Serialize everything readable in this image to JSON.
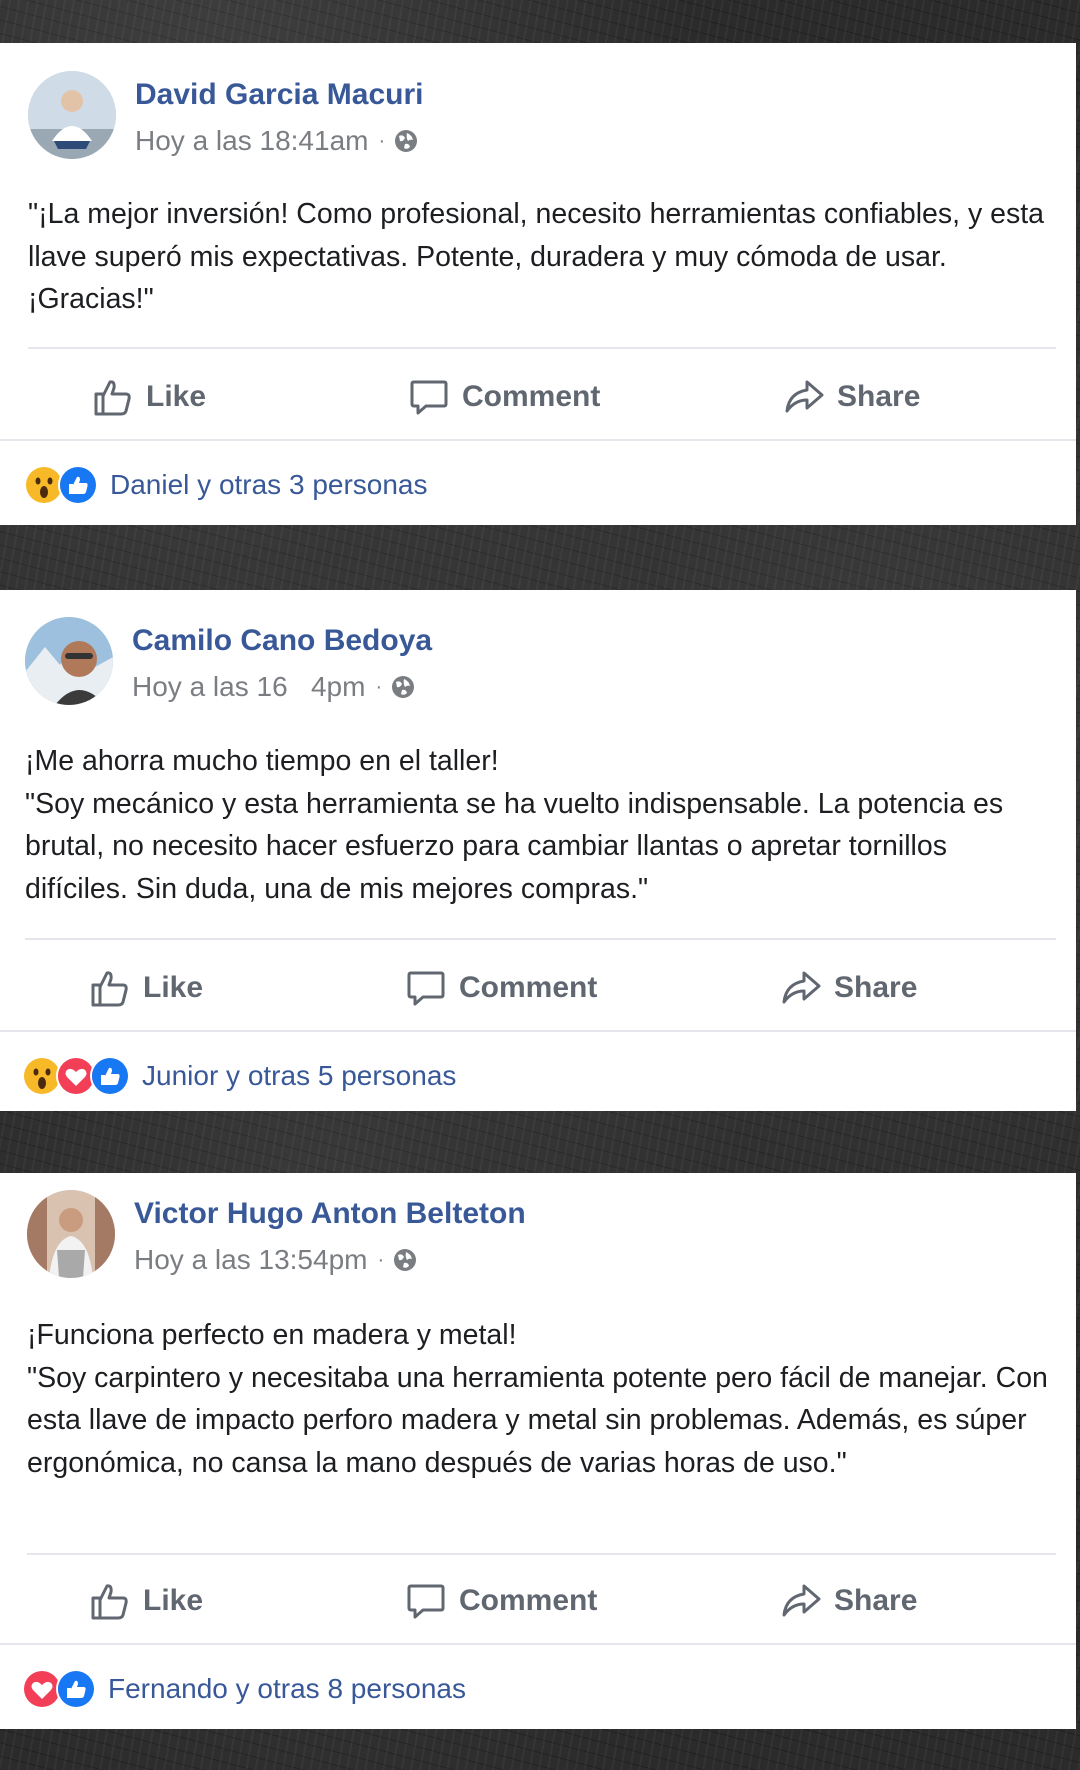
{
  "posts": [
    {
      "author": "David Garcia Macuri",
      "timestamp": "Hoy a las 18:41am",
      "visibility_icon": "globe-icon",
      "body": [
        "\"¡La mejor inversión! Como profesional, necesito herramientas confiables, y esta llave superó mis expectativas. Potente, duradera y muy cómoda de usar. ¡Gracias!\""
      ],
      "actions": {
        "like": "Like",
        "comment": "Comment",
        "share": "Share"
      },
      "reactions": [
        "wow-icon",
        "like-icon"
      ],
      "reactions_summary": "Daniel y otras 3 personas"
    },
    {
      "author": "Camilo Cano Bedoya",
      "timestamp": "Hoy a las 16   4pm",
      "visibility_icon": "globe-icon",
      "body": [
        "¡Me ahorra mucho tiempo en el taller!",
        "\"Soy mecánico y esta herramienta se ha vuelto indispensable. La potencia es brutal, no necesito hacer esfuerzo para cambiar llantas o apretar tornillos difíciles. Sin duda, una de mis mejores compras.\""
      ],
      "actions": {
        "like": "Like",
        "comment": "Comment",
        "share": "Share"
      },
      "reactions": [
        "wow-icon",
        "love-icon",
        "like-icon"
      ],
      "reactions_summary": "Junior y otras 5 personas"
    },
    {
      "author": "Victor Hugo Anton Belteton",
      "timestamp": "Hoy a las 13:54pm",
      "visibility_icon": "globe-icon",
      "body": [
        "¡Funciona perfecto en madera y metal!",
        "\"Soy carpintero y necesitaba una herramienta potente pero fácil de manejar. Con esta llave de impacto perforo madera y metal sin problemas. Además, es súper ergonómica, no cansa la mano después de varias horas de uso.\""
      ],
      "actions": {
        "like": "Like",
        "comment": "Comment",
        "share": "Share"
      },
      "reactions": [
        "love-icon",
        "like-icon"
      ],
      "reactions_summary": "Fernando y otras 8 personas"
    }
  ],
  "colors": {
    "author_blue": "#385898",
    "action_gray": "#616770",
    "meta_gray": "#7a7d82",
    "like_blue": "#1877f2",
    "love_red": "#f33e58",
    "wow_yellow": "#f7b928"
  }
}
